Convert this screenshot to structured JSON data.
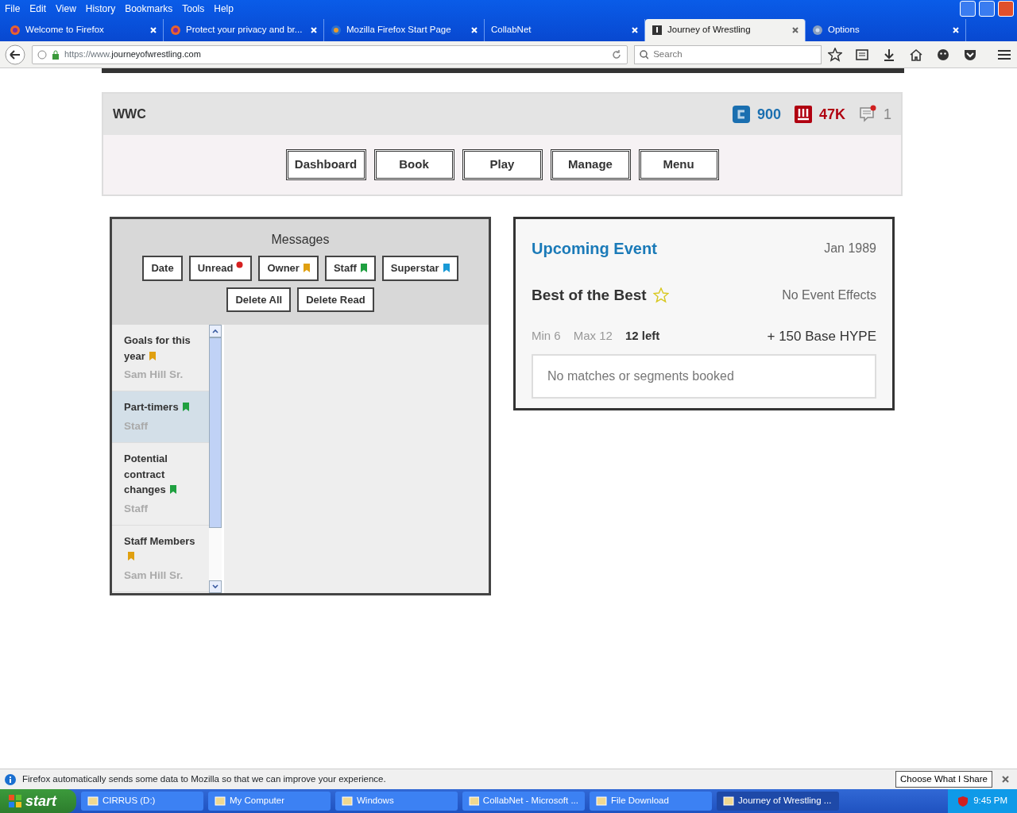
{
  "menu": [
    "File",
    "Edit",
    "View",
    "History",
    "Bookmarks",
    "Tools",
    "Help"
  ],
  "tabs": [
    {
      "label": "Welcome to Firefox",
      "kind": "firefox",
      "selected": false
    },
    {
      "label": "Protect your privacy and br...",
      "kind": "firefox",
      "selected": false
    },
    {
      "label": "Mozilla Firefox Start Page",
      "kind": "globe",
      "selected": false
    },
    {
      "label": "CollabNet",
      "kind": "none",
      "selected": false
    },
    {
      "label": "Journey of Wrestling",
      "kind": "site",
      "selected": true
    },
    {
      "label": "Options",
      "kind": "gear",
      "selected": false
    }
  ],
  "address": {
    "prefix": "https://www.",
    "domain": "journeyofwrestling.com"
  },
  "search": {
    "placeholder": "Search"
  },
  "header": {
    "brand": "WWC",
    "stats": [
      {
        "kind": "coin",
        "value": "900",
        "color": "#1a6fb0"
      },
      {
        "kind": "hype",
        "value": "47K",
        "color": "#b00010"
      },
      {
        "kind": "messages",
        "value": "1",
        "color": "#888888"
      }
    ]
  },
  "nav_buttons": [
    "Dashboard",
    "Book",
    "Play",
    "Manage",
    "Menu"
  ],
  "messages": {
    "title": "Messages",
    "filters": [
      {
        "label": "Date"
      },
      {
        "label": "Unread",
        "color": "#d62020"
      },
      {
        "label": "Owner",
        "color": "#e0a010"
      },
      {
        "label": "Staff",
        "color": "#1fa040"
      },
      {
        "label": "Superstar",
        "color": "#1a9ad6"
      }
    ],
    "actions": [
      "Delete All",
      "Delete Read"
    ],
    "items": [
      {
        "title": "Goals for this year",
        "sender": "Sam Hill Sr.",
        "color": "#e0a010",
        "selected": false
      },
      {
        "title": "Part-timers",
        "sender": "Staff",
        "color": "#1fa040",
        "selected": true
      },
      {
        "title": "Potential contract changes",
        "sender": "Staff",
        "color": "#1fa040",
        "selected": false
      },
      {
        "title": "Staff Members",
        "sender": "Sam Hill Sr.",
        "color": "#e0a010",
        "selected": false
      }
    ]
  },
  "event": {
    "heading": "Upcoming Event",
    "date": "Jan 1989",
    "name": "Best of the Best",
    "effects": "No Event Effects",
    "min": "Min 6",
    "max": "Max 12",
    "left": "12 left",
    "hype": "+ 150 Base HYPE",
    "bookings": "No matches or segments booked"
  },
  "notification": {
    "text": "Firefox automatically sends some data to Mozilla so that we can improve your experience.",
    "button": "Choose What I Share"
  },
  "taskbar": {
    "start": "start",
    "items": [
      {
        "label": "CIRRUS (D:)",
        "selected": false
      },
      {
        "label": "My Computer",
        "selected": false
      },
      {
        "label": "Windows",
        "selected": false
      },
      {
        "label": "CollabNet - Microsoft ...",
        "selected": false
      },
      {
        "label": "File Download",
        "selected": false
      },
      {
        "label": "Journey of Wrestling ...",
        "selected": true
      }
    ],
    "time": "9:45 PM"
  }
}
